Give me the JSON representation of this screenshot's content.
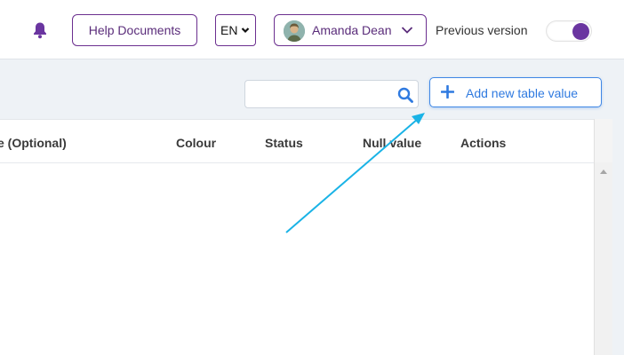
{
  "header": {
    "help_label": "Help Documents",
    "language": "EN",
    "user_name": "Amanda Dean",
    "previous_version_label": "Previous version",
    "previous_version_on": true,
    "accent_color": "#6a35a0"
  },
  "toolbar": {
    "search_value": "",
    "add_label": "Add new table value",
    "add_color": "#2f7ae0"
  },
  "table": {
    "columns": [
      "e (Optional)",
      "Colour",
      "Status",
      "Null value",
      "Actions"
    ],
    "rows": []
  },
  "icons": {
    "notifications": "bell-icon",
    "search": "search-icon",
    "add": "plus-icon",
    "dropdown": "chevron-down-icon"
  },
  "annotation": {
    "arrow_color": "#1ab3e6"
  }
}
